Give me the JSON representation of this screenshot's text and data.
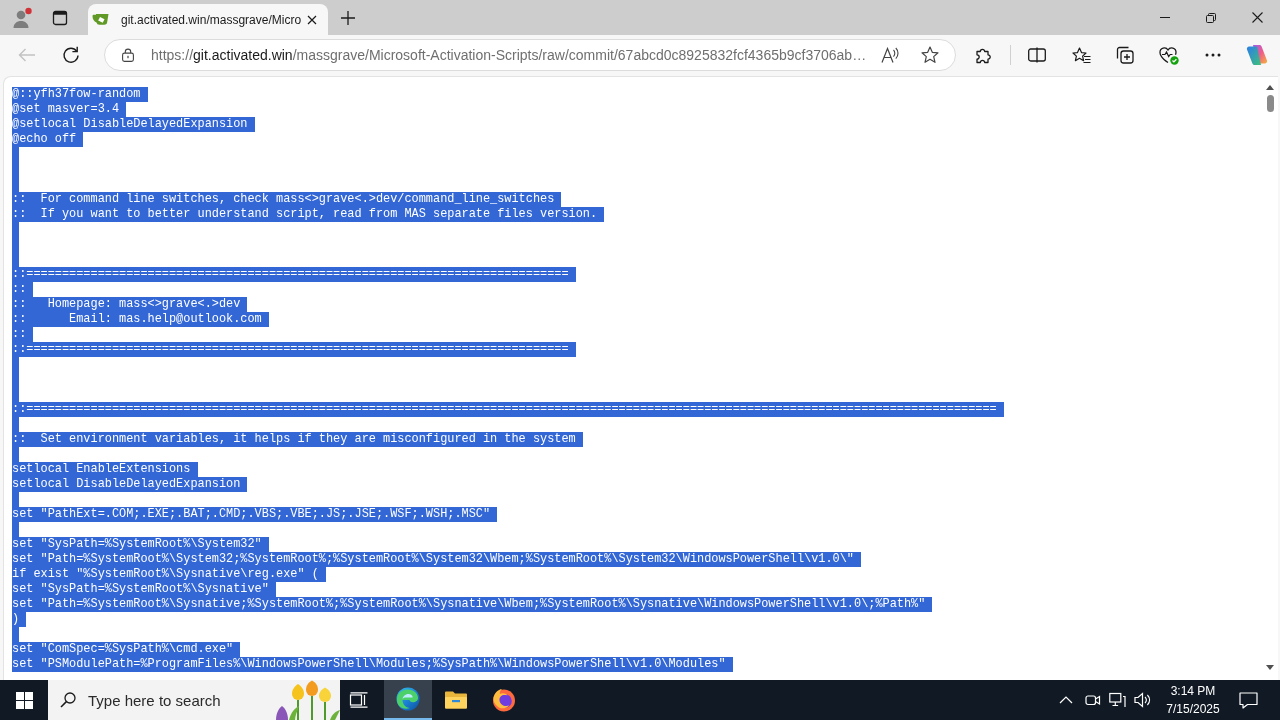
{
  "browser": {
    "profile": {
      "notification": true
    },
    "tabs": [
      {
        "title": "git.activated.win/massgrave/Micro",
        "selected": true
      }
    ],
    "toolbar": {
      "back_button": {
        "disabled": true
      },
      "url": {
        "scheme": "https://",
        "host": "git.activated.win",
        "path": "/massgrave/Microsoft-Activation-Scripts/raw/commit/67abcd0c8925832fcf4365b9cf3706ab…"
      }
    }
  },
  "raw_text": {
    "lines": [
      {
        "kind": "code",
        "text": "@::yfh37fow-random",
        "selected": true
      },
      {
        "kind": "code",
        "text": "@set masver=3.4",
        "selected": true
      },
      {
        "kind": "code",
        "text": "@setlocal DisableDelayedExpansion",
        "selected": true
      },
      {
        "kind": "code",
        "text": "@echo off",
        "selected": true
      },
      {
        "kind": "blank",
        "selected": true
      },
      {
        "kind": "blank",
        "selected": true
      },
      {
        "kind": "blank",
        "selected": true
      },
      {
        "kind": "code",
        "text": "::  For command line switches, check mass<>grave<.>dev/command_line_switches",
        "selected": true
      },
      {
        "kind": "code",
        "text": "::  If you want to better understand script, read from MAS separate files version.",
        "selected": true
      },
      {
        "kind": "blank",
        "selected": true
      },
      {
        "kind": "blank",
        "selected": true
      },
      {
        "kind": "blank",
        "selected": true
      },
      {
        "kind": "code",
        "text": "::============================================================================",
        "selected": true
      },
      {
        "kind": "code",
        "text": "::",
        "selected": true
      },
      {
        "kind": "code",
        "text": "::   Homepage: mass<>grave<.>dev",
        "selected": true
      },
      {
        "kind": "code",
        "text": "::      Email: mas.help@outlook.com",
        "selected": true
      },
      {
        "kind": "code",
        "text": "::",
        "selected": true
      },
      {
        "kind": "code",
        "text": "::============================================================================",
        "selected": true
      },
      {
        "kind": "blank",
        "selected": true
      },
      {
        "kind": "blank",
        "selected": true
      },
      {
        "kind": "blank",
        "selected": true
      },
      {
        "kind": "code",
        "text": "::========================================================================================================================================",
        "selected": true
      },
      {
        "kind": "blank",
        "selected": true
      },
      {
        "kind": "code",
        "text": "::  Set environment variables, it helps if they are misconfigured in the system",
        "selected": true
      },
      {
        "kind": "blank",
        "selected": true
      },
      {
        "kind": "code",
        "text": "setlocal EnableExtensions",
        "selected": true
      },
      {
        "kind": "code",
        "text": "setlocal DisableDelayedExpansion",
        "selected": true
      },
      {
        "kind": "blank",
        "selected": true
      },
      {
        "kind": "code",
        "text": "set \"PathExt=.COM;.EXE;.BAT;.CMD;.VBS;.VBE;.JS;.JSE;.WSF;.WSH;.MSC\"",
        "selected": true
      },
      {
        "kind": "blank",
        "selected": true
      },
      {
        "kind": "code",
        "text": "set \"SysPath=%SystemRoot%\\System32\"",
        "selected": true
      },
      {
        "kind": "code",
        "text": "set \"Path=%SystemRoot%\\System32;%SystemRoot%;%SystemRoot%\\System32\\Wbem;%SystemRoot%\\System32\\WindowsPowerShell\\v1.0\\\"",
        "selected": true
      },
      {
        "kind": "code",
        "text": "if exist \"%SystemRoot%\\Sysnative\\reg.exe\" (",
        "selected": true
      },
      {
        "kind": "code",
        "text": "set \"SysPath=%SystemRoot%\\Sysnative\"",
        "selected": true
      },
      {
        "kind": "code",
        "text": "set \"Path=%SystemRoot%\\Sysnative;%SystemRoot%;%SystemRoot%\\Sysnative\\Wbem;%SystemRoot%\\Sysnative\\WindowsPowerShell\\v1.0\\;%Path%\"",
        "selected": true
      },
      {
        "kind": "code",
        "text": ")",
        "selected": true
      },
      {
        "kind": "blank",
        "selected": true
      },
      {
        "kind": "code",
        "text": "set \"ComSpec=%SysPath%\\cmd.exe\"",
        "selected": true
      },
      {
        "kind": "code",
        "text": "set \"PSModulePath=%ProgramFiles%\\WindowsPowerShell\\Modules;%SysPath%\\WindowsPowerShell\\v1.0\\Modules\"",
        "selected": true
      }
    ]
  },
  "taskbar": {
    "search": {
      "placeholder": "Type here to search"
    },
    "apps": [
      {
        "kind": "taskview",
        "selected": false
      },
      {
        "kind": "edge",
        "selected": true
      },
      {
        "kind": "explorer",
        "selected": false
      },
      {
        "kind": "firefox",
        "selected": false
      }
    ],
    "clock": {
      "time": "3:14 PM",
      "date": "7/15/2025"
    }
  }
}
